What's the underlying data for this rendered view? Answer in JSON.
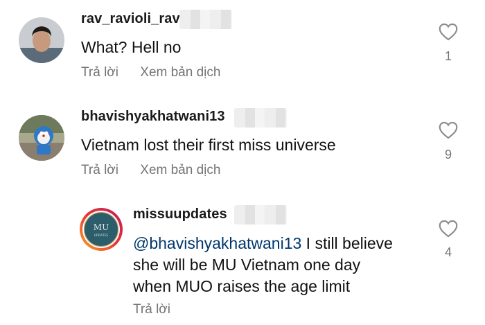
{
  "comments": [
    {
      "username": "rav_ravioli_rav",
      "text": "What? Hell no",
      "reply_label": "Trả lời",
      "translate_label": "Xem bản dịch",
      "likes": "1"
    },
    {
      "username": "bhavishyakhatwani13",
      "text": "Vietnam lost their first miss universe",
      "reply_label": "Trả lời",
      "translate_label": "Xem bản dịch",
      "likes": "9"
    }
  ],
  "reply": {
    "username": "missuupdates",
    "mention": "@bhavishyakhatwani13",
    "text_line1": " I still believe",
    "text_line2": "she will be MU Vietnam one day",
    "text_line3": "when MUO raises the age limit",
    "reply_label": "Trả lời",
    "likes": "4",
    "avatar_text_top": "MU",
    "avatar_text_bottom": "UPDATES"
  },
  "colors": {
    "mention": "#00376b",
    "meta": "#737373",
    "story_ring_start": "#f9a825",
    "story_ring_end": "#c2185b"
  },
  "icons": [
    "heart-outline-icon",
    "avatar-photo",
    "avatar-cartoon",
    "avatar-logo"
  ]
}
